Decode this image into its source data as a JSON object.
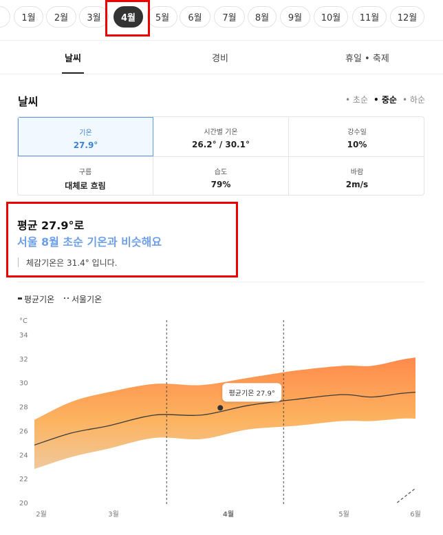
{
  "months": {
    "prev_partial": "",
    "items": [
      "1월",
      "2월",
      "3월",
      "4월",
      "5월",
      "6월",
      "7월",
      "8월",
      "9월",
      "10월",
      "11월",
      "12월"
    ],
    "selected": "4월"
  },
  "tabs": [
    "날씨",
    "경비",
    "휴일 • 축제"
  ],
  "weather": {
    "title": "날씨",
    "periods": [
      "초순",
      "중순",
      "하순"
    ],
    "selected_period": "중순",
    "stats": [
      {
        "label": "기온",
        "value": "27.9°"
      },
      {
        "label": "시간별 기온",
        "value": "26.2° / 30.1°"
      },
      {
        "label": "강수일",
        "value": "10%"
      },
      {
        "label": "구름",
        "value": "대체로 흐림"
      },
      {
        "label": "습도",
        "value": "79%"
      },
      {
        "label": "바람",
        "value": "2m/s"
      }
    ],
    "summary_line1": "평균 27.9°로",
    "summary_line2": "서울 8월 초순 기온과 비슷해요",
    "summary_line3": "체감기온은 31.4° 입니다."
  },
  "legend": {
    "avg": "평균기온",
    "seoul": "서울기온",
    "avg_color": "#333333",
    "seoul_color": "#555555"
  },
  "colors": {
    "accent_blue": "#3d82d6",
    "summary_blue": "#6d9fe8",
    "highlight_red": "#ee0000",
    "band_top": "#ff8a4c",
    "band_bottom": "#f0c89a"
  },
  "chart_data": {
    "type": "area",
    "unit_label": "°C",
    "ylim": [
      20,
      34
    ],
    "yticks": [
      "34",
      "32",
      "30",
      "28",
      "26",
      "24",
      "22",
      "20"
    ],
    "x_labels": [
      "2월",
      "3월",
      "4월",
      "5월",
      "6월"
    ],
    "x_label_bold": "4월",
    "tooltip": "평균기온 27.9°",
    "highlight_point": {
      "x": 3.96,
      "y": 27.9
    },
    "series": [
      {
        "name": "평균기온",
        "points": [
          [
            2.0,
            24.8
          ],
          [
            2.5,
            25.8
          ],
          [
            3.0,
            26.4
          ],
          [
            3.4,
            27.3
          ],
          [
            3.8,
            27.3
          ],
          [
            4.2,
            28.1
          ],
          [
            4.6,
            28.6
          ],
          [
            5.0,
            29.0
          ],
          [
            5.4,
            28.8
          ],
          [
            5.8,
            29.1
          ],
          [
            6.0,
            29.2
          ]
        ]
      },
      {
        "name": "upper",
        "points": [
          [
            2.0,
            26.9
          ],
          [
            2.5,
            28.4
          ],
          [
            3.0,
            29.2
          ],
          [
            3.4,
            29.9
          ],
          [
            3.8,
            29.8
          ],
          [
            4.2,
            30.4
          ],
          [
            4.6,
            31.0
          ],
          [
            5.0,
            31.4
          ],
          [
            5.4,
            31.4
          ],
          [
            5.8,
            31.9
          ],
          [
            6.0,
            32.1
          ]
        ]
      },
      {
        "name": "lower",
        "points": [
          [
            2.0,
            22.8
          ],
          [
            2.5,
            23.8
          ],
          [
            3.0,
            24.5
          ],
          [
            3.4,
            25.4
          ],
          [
            3.8,
            25.3
          ],
          [
            4.2,
            26.1
          ],
          [
            4.6,
            26.4
          ],
          [
            5.0,
            26.8
          ],
          [
            5.4,
            26.8
          ],
          [
            5.8,
            27.0
          ],
          [
            6.0,
            27.0
          ]
        ]
      },
      {
        "name": "서울기온",
        "points": [
          [
            5.75,
            20.0
          ],
          [
            6.0,
            21.2
          ]
        ]
      }
    ],
    "vertical_markers": [
      3.5,
      4.5
    ],
    "grid": false,
    "legend_position": "top-left"
  }
}
